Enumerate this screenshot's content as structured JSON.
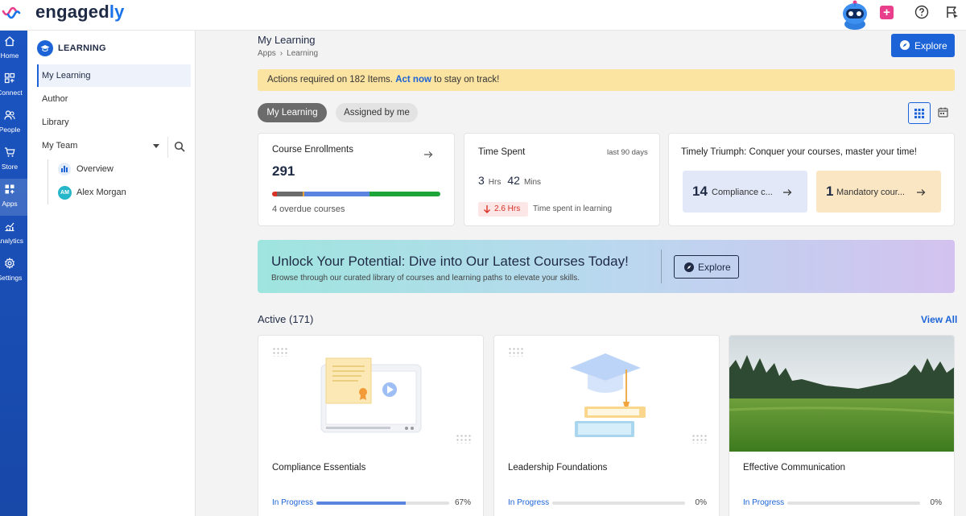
{
  "app": {
    "logo_main": "engaged",
    "logo_accent": "ly"
  },
  "rail": [
    {
      "label": "Home",
      "icon": "home-icon"
    },
    {
      "label": "Connect",
      "icon": "connect-icon"
    },
    {
      "label": "People",
      "icon": "people-icon"
    },
    {
      "label": "Store",
      "icon": "cart-icon"
    },
    {
      "label": "Apps",
      "icon": "apps-icon"
    },
    {
      "label": "Analytics",
      "icon": "analytics-icon"
    },
    {
      "label": "Settings",
      "icon": "gear-icon"
    }
  ],
  "sidebar": {
    "title": "LEARNING",
    "items": [
      "My Learning",
      "Author",
      "Library",
      "My Team"
    ],
    "team": [
      "Overview",
      "Alex Morgan"
    ],
    "avatar_initials": "AM"
  },
  "header": {
    "title": "My Learning",
    "breadcrumb": [
      "Apps",
      "Learning"
    ],
    "explore_label": "Explore"
  },
  "alert": {
    "prefix": "Actions required on 182 Items.",
    "link": "Act now",
    "suffix": "to stay on track!"
  },
  "tabs": [
    "My Learning",
    "Assigned by me"
  ],
  "enrollments": {
    "title": "Course Enrollments",
    "count": "291",
    "overdue": "4 overdue courses",
    "segments": [
      {
        "color": "#d93025",
        "share": 0.03
      },
      {
        "color": "#6b6b6b",
        "share": 0.15
      },
      {
        "color": "#e8a33d",
        "share": 0.01
      },
      {
        "color": "#5a84e0",
        "share": 0.39
      },
      {
        "color": "#1ea53a",
        "share": 0.42
      }
    ]
  },
  "time_spent": {
    "title": "Time Spent",
    "range": "last 90 days",
    "hours": "3",
    "hours_unit": "Hrs",
    "mins": "42",
    "mins_unit": "Mins",
    "delta": "2.6 Hrs",
    "delta_label": "Time spent in learning"
  },
  "triumph": {
    "title": "Timely Triumph: Conquer your courses, master your time!",
    "tiles": [
      {
        "count": "14",
        "label": "Compliance c..."
      },
      {
        "count": "1",
        "label": "Mandatory cour..."
      }
    ]
  },
  "banner": {
    "heading": "Unlock Your Potential: Dive into Our Latest Courses Today!",
    "sub": "Browse through our curated library of courses and learning paths to elevate your skills.",
    "button": "Explore"
  },
  "active": {
    "title": "Active (171)",
    "view_all": "View All",
    "courses": [
      {
        "title": "Compliance Essentials",
        "status": "In Progress",
        "progress": 67,
        "pct": "67%"
      },
      {
        "title": "Leadership Foundations",
        "status": "In Progress",
        "progress": 0,
        "pct": "0%"
      },
      {
        "title": "Effective Communication",
        "status": "In Progress",
        "progress": 0,
        "pct": "0%"
      }
    ]
  },
  "colors": {
    "primary": "#1b63d6",
    "rail": "#1b55c2",
    "alert": "#fbe3a1"
  }
}
